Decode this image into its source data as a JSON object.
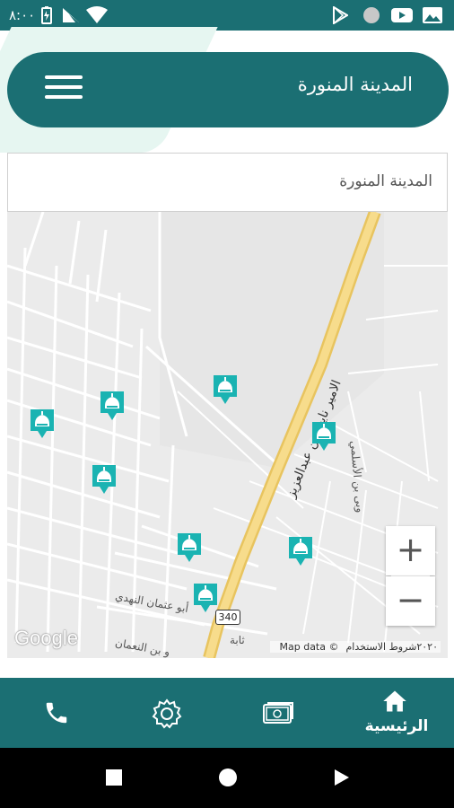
{
  "status_bar": {
    "time": "٨:٠٠",
    "icons": [
      "battery-icon",
      "signal-icon",
      "wifi-icon",
      "play-store-icon",
      "circle-icon",
      "youtube-icon",
      "gallery-icon"
    ]
  },
  "header": {
    "title": "المدينة المنورة",
    "menu_icon": "hamburger-menu-icon"
  },
  "city_field": {
    "value": "المدينة المنورة"
  },
  "map": {
    "road_main": "الامير نايف بن عبدالعزيز",
    "road_small_1": "أبو عثمان النهدي",
    "road_small_2": "و بن النعمان",
    "road_small_3": "وبى بن الأسلمي",
    "road_small_4": "ثابة",
    "highway_shield": "340",
    "attribution_data": "Map data ©٢٠٢٠",
    "attribution_terms": "شروط الاستخدام",
    "google_logo": "Google",
    "zoom_in": "+",
    "zoom_out": "−",
    "pin_icon": "mosque-marker-icon",
    "pin_color": "#1ab3b2"
  },
  "bottom_nav": {
    "home_label": "الرئيسية",
    "items": [
      "phone-icon",
      "settings-icon",
      "money-icon",
      "home-icon"
    ]
  },
  "colors": {
    "primary": "#1b6f73",
    "accent": "#1ab3b2",
    "highway": "#f2d27a"
  }
}
